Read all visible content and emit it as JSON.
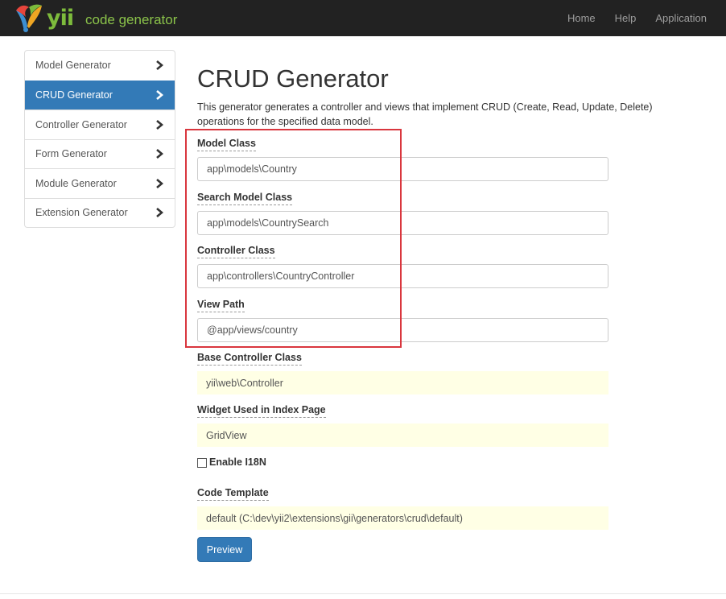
{
  "navbar": {
    "brand_yii": "yii",
    "brand_text": "code generator",
    "links": [
      "Home",
      "Help",
      "Application"
    ]
  },
  "sidebar": {
    "items": [
      {
        "label": "Model Generator"
      },
      {
        "label": "CRUD Generator",
        "active": true
      },
      {
        "label": "Controller Generator"
      },
      {
        "label": "Form Generator"
      },
      {
        "label": "Module Generator"
      },
      {
        "label": "Extension Generator"
      }
    ]
  },
  "main": {
    "title": "CRUD Generator",
    "description": "This generator generates a controller and views that implement CRUD (Create, Read, Update, Delete) operations for the specified data model."
  },
  "form": {
    "model_class": {
      "label": "Model Class",
      "value": "app\\models\\Country"
    },
    "search_model_class": {
      "label": "Search Model Class",
      "value": "app\\models\\CountrySearch"
    },
    "controller_class": {
      "label": "Controller Class",
      "value": "app\\controllers\\CountryController"
    },
    "view_path": {
      "label": "View Path",
      "value": "@app/views/country"
    },
    "base_controller_class": {
      "label": "Base Controller Class",
      "value": "yii\\web\\Controller"
    },
    "index_widget": {
      "label": "Widget Used in Index Page",
      "value": "GridView"
    },
    "enable_i18n": {
      "label": "Enable I18N",
      "checked": false
    },
    "code_template": {
      "label": "Code Template",
      "value": "default (C:\\dev\\yii2\\extensions\\gii\\generators\\crud\\default)"
    },
    "preview_label": "Preview"
  },
  "colors": {
    "navbar_bg": "#222222",
    "brand_green": "#7dbb3c",
    "active_blue": "#337ab7",
    "sticky_bg": "#ffffe5",
    "highlight_red": "#d9363e"
  }
}
